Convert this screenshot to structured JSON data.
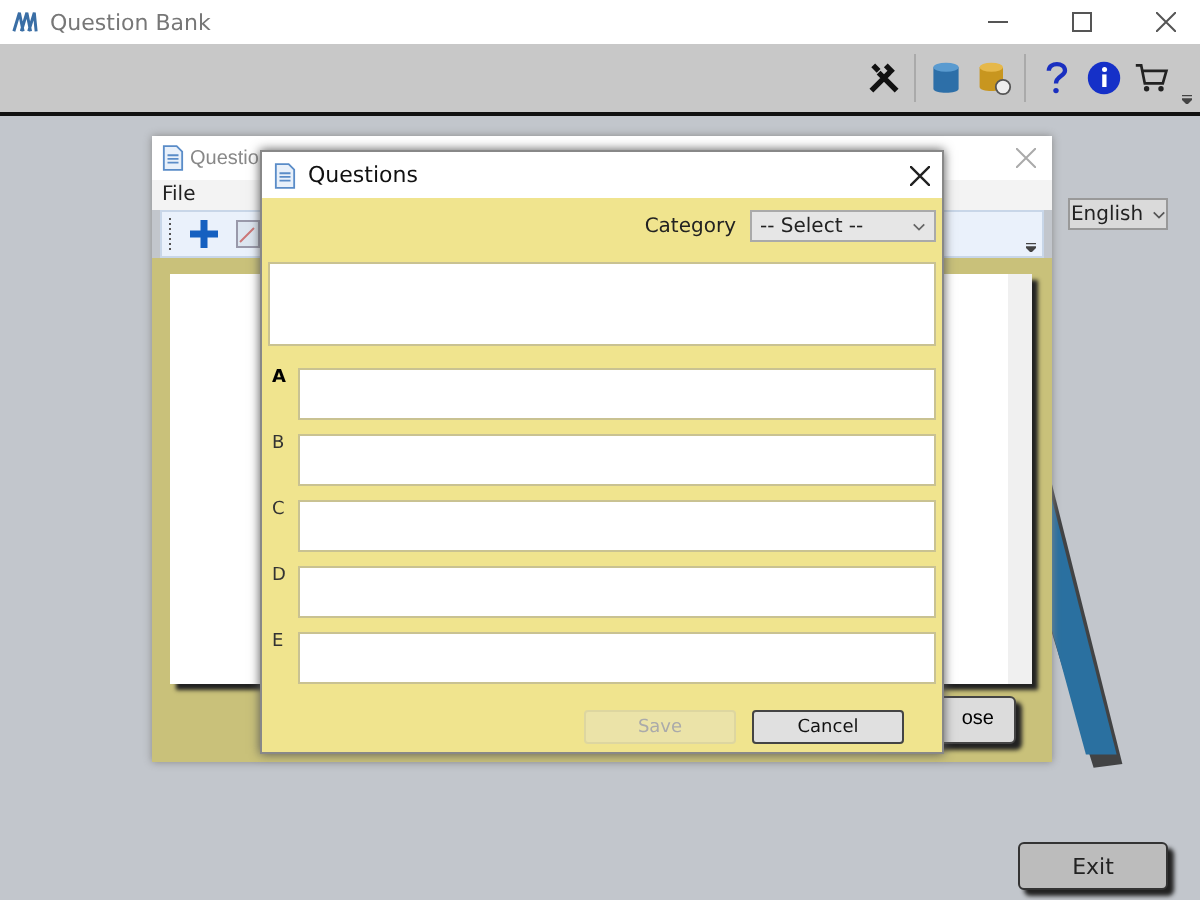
{
  "app": {
    "title": "Question Bank",
    "language": "English",
    "exit": "Exit"
  },
  "back_window": {
    "title": "Questio",
    "menu": [
      "File"
    ],
    "button": "ose"
  },
  "dialog": {
    "title": "Questions",
    "category": {
      "label": "Category",
      "value": "-- Select --"
    },
    "options": [
      {
        "label": "A",
        "focused": true
      },
      {
        "label": "B",
        "focused": false
      },
      {
        "label": "C",
        "focused": false
      },
      {
        "label": "D",
        "focused": false
      },
      {
        "label": "E",
        "focused": false
      }
    ],
    "buttons": [
      {
        "label": "Save",
        "disabled": true
      },
      {
        "label": "Cancel",
        "disabled": false
      }
    ]
  }
}
